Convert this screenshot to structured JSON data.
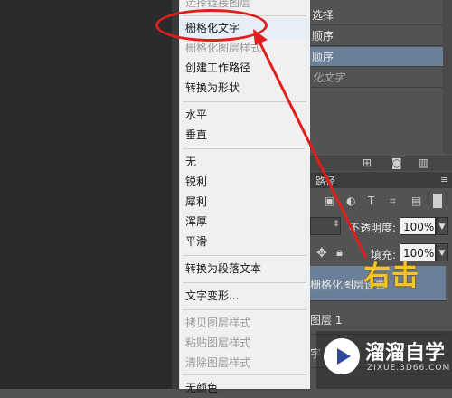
{
  "menu": {
    "items": [
      {
        "label": "选择链接图层",
        "disabled": true
      },
      {
        "label": "栅格化文字",
        "disabled": false,
        "highlight": true
      },
      {
        "label": "栅格化图层样式",
        "disabled": true
      },
      {
        "label": "创建工作路径",
        "disabled": false
      },
      {
        "label": "转换为形状",
        "disabled": false
      },
      {
        "label": "水平",
        "disabled": false
      },
      {
        "label": "垂直",
        "disabled": false
      },
      {
        "label": "无",
        "disabled": false
      },
      {
        "label": "锐利",
        "disabled": false
      },
      {
        "label": "犀利",
        "disabled": false
      },
      {
        "label": "浑厚",
        "disabled": false
      },
      {
        "label": "平滑",
        "disabled": false
      },
      {
        "label": "转换为段落文本",
        "disabled": false
      },
      {
        "label": "文字变形...",
        "disabled": false
      },
      {
        "label": "拷贝图层样式",
        "disabled": true
      },
      {
        "label": "粘贴图层样式",
        "disabled": true
      },
      {
        "label": "清除图层样式",
        "disabled": true
      },
      {
        "label": "无颜色",
        "disabled": false
      }
    ]
  },
  "layers_top": {
    "rows": [
      "选择",
      "顺序",
      "顺序",
      "化文字"
    ]
  },
  "panel": {
    "tab_label": "路径",
    "opacity_label": "不透明度:",
    "opacity_value": "100%",
    "fill_label": "填充:",
    "fill_value": "100%",
    "layer_rows": [
      "栅格化图层设置",
      "图层 1",
      "字"
    ]
  },
  "annotation": {
    "text": "右击",
    "circle_color": "#e11e1e",
    "text_color": "#f5c518"
  },
  "watermark": {
    "title": "溜溜自学",
    "subtitle": "ZIXUE.3D66.COM"
  }
}
